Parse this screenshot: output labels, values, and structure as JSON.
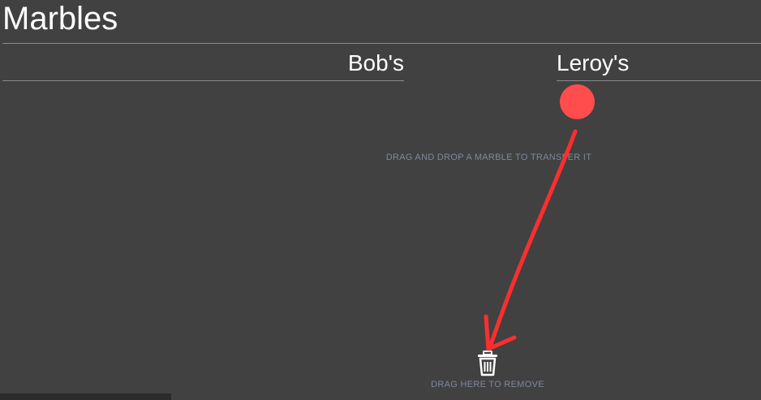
{
  "app": {
    "title": "Marbles"
  },
  "columns": [
    {
      "label": "Bob's",
      "marbles": []
    },
    {
      "label": "Leroy's",
      "marbles": [
        {
          "color": "#ff4d4d"
        }
      ]
    }
  ],
  "hint_text": "DRAG AND DROP A MARBLE TO TRANSFER IT",
  "trash": {
    "icon": "trash-icon",
    "label": "DRAG HERE TO REMOVE"
  },
  "colors": {
    "background": "#414141",
    "marble": "#ff4d4d",
    "annotation_arrow": "#ff2e2e",
    "hint_text": "#7f889a"
  }
}
